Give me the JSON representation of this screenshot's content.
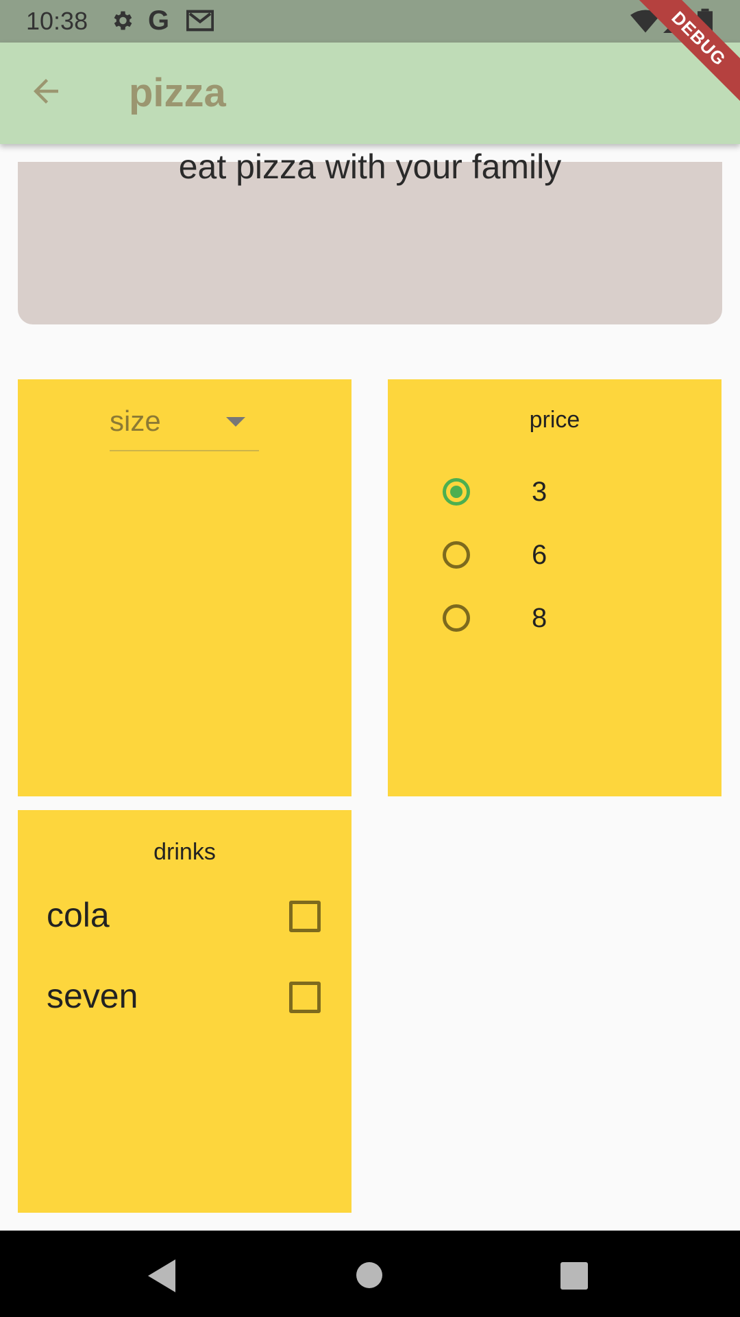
{
  "status_bar": {
    "time": "10:38",
    "left_icons": [
      "gear-icon",
      "google-icon",
      "gmail-icon"
    ],
    "right_icons": [
      "wifi-icon",
      "signal-icon",
      "battery-icon"
    ]
  },
  "app_bar": {
    "title": "pizza",
    "back_icon": "arrow-left-icon",
    "debug_label": "DEBUG"
  },
  "hero": {
    "text": "eat pizza with your family"
  },
  "size_panel": {
    "dropdown_value": "size"
  },
  "price_panel": {
    "title": "price",
    "options": [
      {
        "label": "3",
        "selected": true
      },
      {
        "label": "6",
        "selected": false
      },
      {
        "label": "8",
        "selected": false
      }
    ]
  },
  "drinks_panel": {
    "title": "drinks",
    "items": [
      {
        "label": "cola",
        "checked": false
      },
      {
        "label": "seven",
        "checked": false
      }
    ]
  },
  "nav_bar": {
    "icons": [
      "back-triangle-icon",
      "home-circle-icon",
      "recents-square-icon"
    ]
  },
  "colors": {
    "app_bar_bg": "#bfdcb7",
    "panel_bg": "#fdd63d",
    "hero_bg": "#d9cfcb",
    "radio_selected": "#4caf50",
    "debug_banner": "#b5413f"
  }
}
